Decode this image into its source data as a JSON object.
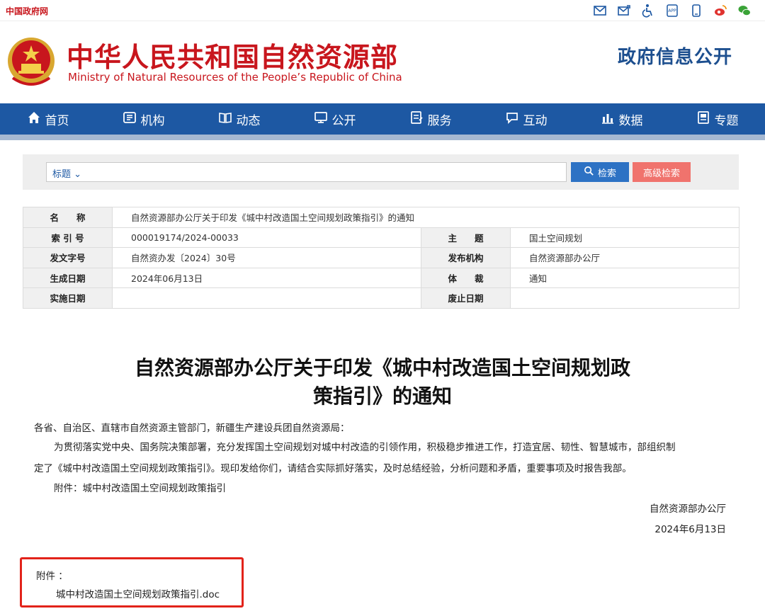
{
  "topbar": {
    "gov_link": "中国政府网",
    "icons": [
      "mail-icon",
      "mail-edit-icon",
      "accessibility-icon",
      "app-icon",
      "mobile-icon",
      "weibo-icon",
      "wechat-icon"
    ]
  },
  "header": {
    "title_cn": "中华人民共和国自然资源部",
    "title_en": "Ministry of Natural Resources of the People’s Republic of China",
    "gov_info": "政府信息公开"
  },
  "nav": {
    "items": [
      {
        "label": "首页",
        "icon": "home-icon"
      },
      {
        "label": "机构",
        "icon": "org-icon"
      },
      {
        "label": "动态",
        "icon": "news-icon"
      },
      {
        "label": "公开",
        "icon": "public-icon"
      },
      {
        "label": "服务",
        "icon": "service-icon"
      },
      {
        "label": "互动",
        "icon": "chat-icon"
      },
      {
        "label": "数据",
        "icon": "data-icon"
      },
      {
        "label": "专题",
        "icon": "topic-icon"
      }
    ]
  },
  "search": {
    "type_label": "标题",
    "search_label": "检索",
    "advanced_label": "高级检索"
  },
  "meta": {
    "name_label": "名　　称",
    "name_value": "自然资源部办公厅关于印发《城中村改造国土空间规划政策指引》的通知",
    "index_label": "索 引 号",
    "index_value": "000019174/2024-00033",
    "subject_label": "主　　题",
    "subject_value": "国土空间规划",
    "doc_no_label": "发文字号",
    "doc_no_value": "自然资办发〔2024〕30号",
    "issuer_label": "发布机构",
    "issuer_value": "自然资源部办公厅",
    "created_label": "生成日期",
    "created_value": "2024年06月13日",
    "genre_label": "体　　裁",
    "genre_value": "通知",
    "effective_label": "实施日期",
    "effective_value": "",
    "expire_label": "废止日期",
    "expire_value": ""
  },
  "article": {
    "title_line1": "自然资源部办公厅关于印发《城中村改造国土空间规划政",
    "title_line2": "策指引》的通知",
    "salutation": "各省、自治区、直辖市自然资源主管部门，新疆生产建设兵团自然资源局：",
    "para1_line1": "为贯彻落实党中央、国务院决策部署，充分发挥国土空间规划对城中村改造的引领作用，积极稳步推进工作，打造宜居、韧性、智慧城市，部组织制",
    "para1_line2": "定了《城中村改造国土空间规划政策指引》。现印发给你们，请结合实际抓好落实，及时总结经验，分析问题和矛盾，重要事项及时报告我部。",
    "attachment_note": "附件：城中村改造国土空间规划政策指引",
    "signature": "自然资源部办公厅",
    "date": "2024年6月13日"
  },
  "attachments": {
    "label": "附件 ：",
    "file": "城中村改造国土空间规划政策指引.doc"
  }
}
